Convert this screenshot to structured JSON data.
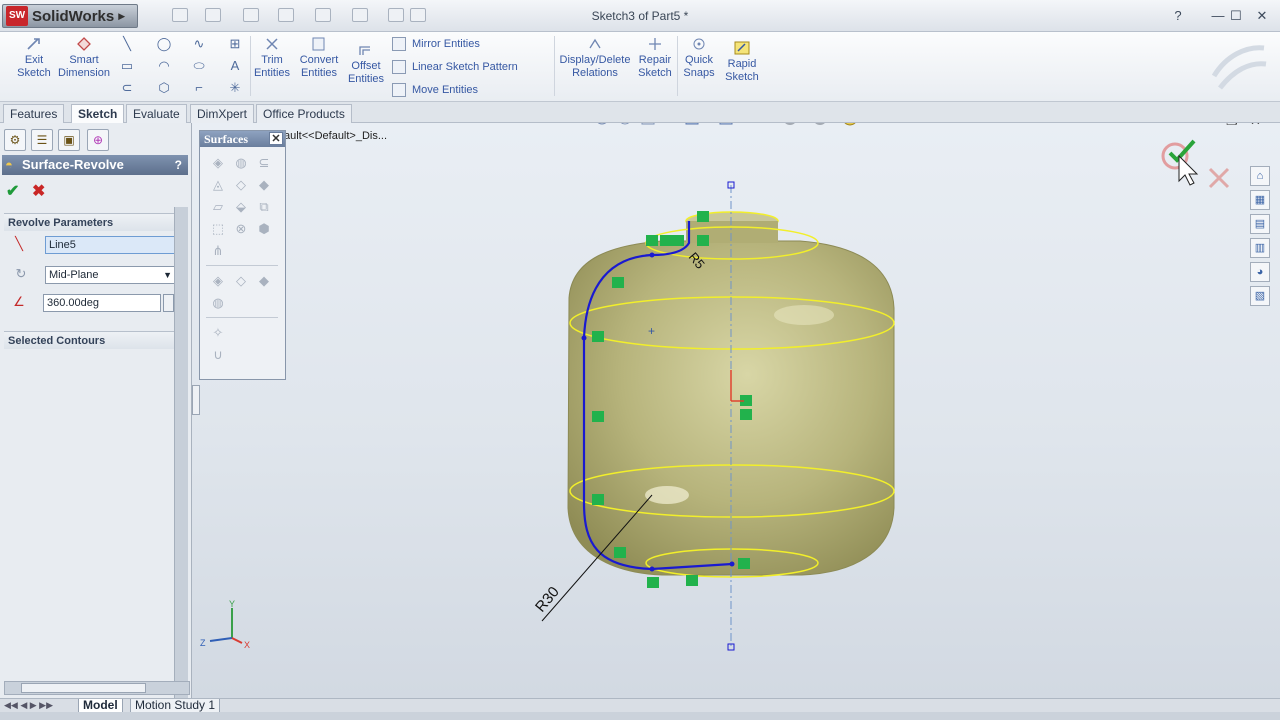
{
  "app": {
    "brand": "SolidWorks",
    "badge": "SW",
    "document_title": "Sketch3 of Part5 *"
  },
  "window": {
    "help": "?",
    "minimize": "—",
    "maximize": "☐",
    "close": "✕"
  },
  "ribbon": {
    "exit_sketch": [
      "Exit",
      "Sketch"
    ],
    "smart_dimension": [
      "Smart",
      "Dimension"
    ],
    "trim_entities": [
      "Trim",
      "Entities"
    ],
    "convert_entities": [
      "Convert",
      "Entities"
    ],
    "offset_entities": [
      "Offset",
      "Entities"
    ],
    "mirror_entities": "Mirror Entities",
    "linear_pattern": "Linear Sketch Pattern",
    "move_entities": "Move Entities",
    "display_relations": [
      "Display/Delete",
      "Relations"
    ],
    "repair_sketch": [
      "Repair",
      "Sketch"
    ],
    "quick_snaps": [
      "Quick",
      "Snaps"
    ],
    "rapid_sketch": [
      "Rapid",
      "Sketch"
    ]
  },
  "tabs": [
    "Features",
    "Sketch",
    "Evaluate",
    "DimXpert",
    "Office Products"
  ],
  "active_tab": "Sketch",
  "tree_fragment": "ault<<Default>_Dis...",
  "property_manager": {
    "title": "Surface-Revolve",
    "help": "?",
    "group_revolve": "Revolve Parameters",
    "axis_value": "Line5",
    "direction_value": "Mid-Plane",
    "angle_value": "360.00deg",
    "group_contours": "Selected Contours"
  },
  "surfaces_toolbar": {
    "title": "Surfaces",
    "close": "✕"
  },
  "sketch": {
    "dim_radius": "R30",
    "dim_small": "R5"
  },
  "bottom_tabs": [
    "Model",
    "Motion Study 1"
  ],
  "triad": {
    "x": "X",
    "y": "Y",
    "z": "Z"
  },
  "colors": {
    "accent": "#3658a3",
    "sketch": "#1a1ad0",
    "surface": "#b5b27a",
    "edge": "#f2ef2a"
  }
}
